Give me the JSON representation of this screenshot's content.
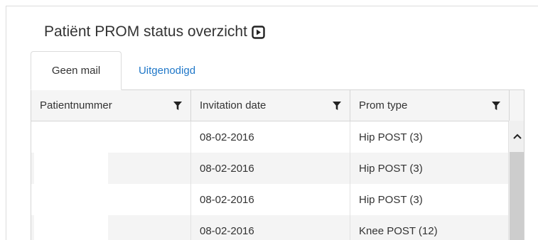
{
  "panel": {
    "title": "Patiënt PROM status overzicht",
    "title_icon": "play-square-icon"
  },
  "tabs": [
    {
      "label": "Geen mail",
      "active": true
    },
    {
      "label": "Uitgenodigd",
      "active": false
    }
  ],
  "grid": {
    "columns": [
      {
        "label": "Patientnummer",
        "icon": "filter-icon"
      },
      {
        "label": "Invitation date",
        "icon": "filter-icon"
      },
      {
        "label": "Prom type",
        "icon": "filter-icon"
      }
    ],
    "rows": [
      {
        "patientnummer": "",
        "invitation_date": "08-02-2016",
        "prom_type": "Hip POST (3)"
      },
      {
        "patientnummer": "",
        "invitation_date": "08-02-2016",
        "prom_type": "Hip POST (3)"
      },
      {
        "patientnummer": "",
        "invitation_date": "08-02-2016",
        "prom_type": "Hip POST (3)"
      },
      {
        "patientnummer": "",
        "invitation_date": "08-02-2016",
        "prom_type": "Knee POST (12)"
      }
    ]
  },
  "colors": {
    "tab_link": "#1f77c8",
    "header_bg": "#f5f5f5",
    "row_alt_bg": "#f4f4f4",
    "scroll_thumb": "#cdcdcd"
  }
}
